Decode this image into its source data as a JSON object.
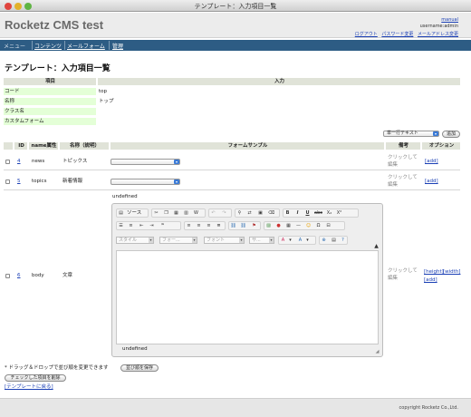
{
  "window": {
    "title": "テンプレート：入力項目一覧"
  },
  "header": {
    "site_title": "Rocketz CMS test",
    "manual": "manual",
    "username": "username:admin",
    "links": [
      "ログアウト",
      "パスワード変更",
      "メールアドレス変更"
    ]
  },
  "nav": {
    "items": [
      "メニュー",
      "コンテンツ",
      "メールフォーム",
      "管理"
    ]
  },
  "page": {
    "title": "テンプレート：入力項目一覧"
  },
  "info_table": {
    "headers": [
      "項目",
      "入力"
    ],
    "rows": [
      {
        "label": "コード",
        "value": "top"
      },
      {
        "label": "名称",
        "value": "トップ"
      },
      {
        "label": "クラス名",
        "value": ""
      },
      {
        "label": "カスタムフォーム",
        "value": ""
      }
    ]
  },
  "add_control": {
    "select_value": "単一行テキスト",
    "add_button": "追加"
  },
  "fields_table": {
    "headers": [
      "ID",
      "name属性",
      "名称（説明）",
      "フォームサンプル",
      "備考",
      "オプション"
    ],
    "rows": [
      {
        "id": "4",
        "name": "news",
        "label": "トピックス",
        "note": "クリックして編集",
        "options": [
          "[add]"
        ]
      },
      {
        "id": "5",
        "name": "topics",
        "label": "新着情報",
        "note": "クリックして編集",
        "options": [
          "[add]"
        ]
      },
      {
        "id": "6",
        "name": "body",
        "label": "文章",
        "note": "クリックして編集",
        "options": [
          "[height]",
          "[width]",
          "[add]"
        ]
      }
    ]
  },
  "editor": {
    "top_label": "undefined",
    "source_label": "ソース",
    "style_combo": "スタイル",
    "format_combo": "フォー...",
    "font_combo": "フォント",
    "size_combo": "サ...",
    "status_label": "undefined"
  },
  "footer_actions": {
    "drag_note": "* ドラッグ＆ドロップで並び順を変更できます",
    "save_order": "並び順を保存",
    "delete_checked": "チェックした項目を削除",
    "back_link": "[テンプレートに戻る]"
  },
  "footer": {
    "copyright": "copyright Rocketz Co.,Ltd."
  },
  "colors": {
    "nav": "#2d5c84",
    "label_bg": "#e4ffd7",
    "header_bg": "#e0e3d8"
  }
}
